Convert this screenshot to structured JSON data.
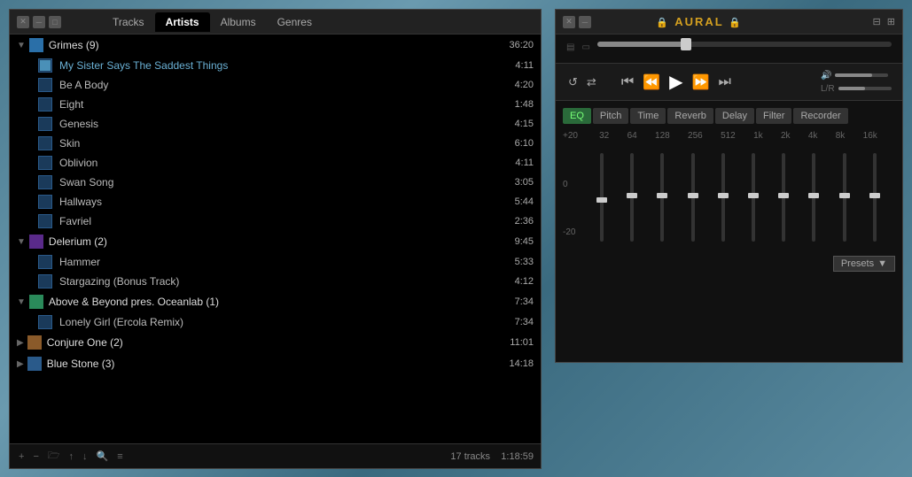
{
  "tabs": {
    "tracks": "Tracks",
    "artists": "Artists",
    "albums": "Albums",
    "genres": "Genres",
    "active": "Artists"
  },
  "artists": [
    {
      "name": "Grimes (9)",
      "duration": "36:20",
      "expanded": true,
      "tracks": [
        {
          "name": "My Sister Says The Saddest Things",
          "duration": "4:11",
          "playing": true
        },
        {
          "name": "Be A Body",
          "duration": "4:20",
          "playing": false
        },
        {
          "name": "Eight",
          "duration": "1:48",
          "playing": false
        },
        {
          "name": "Genesis",
          "duration": "4:15",
          "playing": false
        },
        {
          "name": "Skin",
          "duration": "6:10",
          "playing": false
        },
        {
          "name": "Oblivion",
          "duration": "4:11",
          "playing": false
        },
        {
          "name": "Swan Song",
          "duration": "3:05",
          "playing": false
        },
        {
          "name": "Hallways",
          "duration": "5:44",
          "playing": false
        },
        {
          "name": "Favriel",
          "duration": "2:36",
          "playing": false
        }
      ]
    },
    {
      "name": "Delerium (2)",
      "duration": "9:45",
      "expanded": true,
      "tracks": [
        {
          "name": "Hammer",
          "duration": "5:33",
          "playing": false
        },
        {
          "name": "Stargazing (Bonus Track)",
          "duration": "4:12",
          "playing": false
        }
      ]
    },
    {
      "name": "Above & Beyond pres. Oceanlab (1)",
      "duration": "7:34",
      "expanded": true,
      "tracks": [
        {
          "name": "Lonely Girl (Ercola Remix)",
          "duration": "7:34",
          "playing": false
        }
      ]
    },
    {
      "name": "Conjure One (2)",
      "duration": "11:01",
      "expanded": false,
      "tracks": []
    },
    {
      "name": "Blue Stone (3)",
      "duration": "14:18",
      "expanded": false,
      "tracks": []
    }
  ],
  "bottomBar": {
    "trackCount": "17 tracks",
    "totalDuration": "1:18:59"
  },
  "player": {
    "title": "AURAL",
    "progress": 30,
    "eq": {
      "tabs": [
        "EQ",
        "Pitch",
        "Time",
        "Reverb",
        "Delay",
        "Filter",
        "Recorder"
      ],
      "activeTab": "EQ",
      "freqLabels": [
        "32",
        "64",
        "128",
        "256",
        "512",
        "1k",
        "2k",
        "4k",
        "8k",
        "16k"
      ],
      "dbLabels": [
        "+20",
        "0",
        "-20"
      ],
      "sliderPositions": [
        50,
        45,
        45,
        45,
        45,
        45,
        45,
        45,
        45,
        45
      ],
      "presetsLabel": "Presets"
    }
  }
}
